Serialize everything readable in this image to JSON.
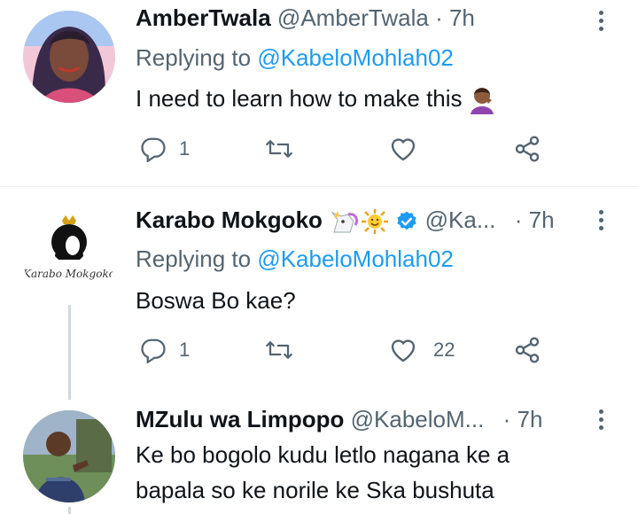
{
  "tweets": [
    {
      "name": "AmberTwala",
      "handle": "@AmberTwala",
      "separator": "·",
      "time": "7h",
      "replying_prefix": "Replying to ",
      "replying_to": "@KabeloMohlah02",
      "text": "I need to learn how to make this",
      "reply_count": "1",
      "retweet_count": "",
      "like_count": ""
    },
    {
      "name": "Karabo Mokgoko",
      "handle": "@Ka...",
      "separator": "·",
      "time": "7h",
      "replying_prefix": "Replying to ",
      "replying_to": "@KabeloMohlah02",
      "text": "Boswa Bo kae?",
      "reply_count": "1",
      "retweet_count": "",
      "like_count": "22",
      "avatar_text": "Karabo Mokgoko"
    },
    {
      "name": "MZulu wa Limpopo",
      "handle": "@KabeloM...",
      "separator": "·",
      "time": "7h",
      "text_line1": "Ke bo bogolo kudu letlo nagana ke a",
      "text_line2": "bapala so ke norile ke Ska bushuta"
    }
  ],
  "colors": {
    "accent": "#1d9bf0",
    "secondary_text": "#536471",
    "primary_text": "#0f1419",
    "verified": "#1d9bf0"
  },
  "icons": [
    "reply-icon",
    "retweet-icon",
    "like-icon",
    "share-icon",
    "more-icon",
    "verified-badge-icon"
  ]
}
